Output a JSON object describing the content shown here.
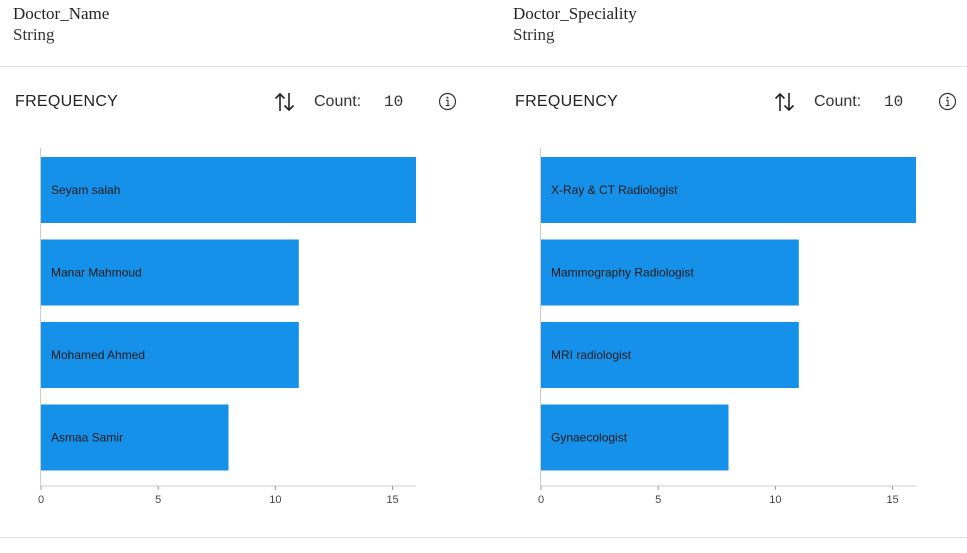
{
  "panels": [
    {
      "column_name": "Doctor_Name",
      "column_type": "String",
      "frequency_label": "FREQUENCY",
      "count_label": "Count:",
      "count_value": "10"
    },
    {
      "column_name": "Doctor_Speciality",
      "column_type": "String",
      "frequency_label": "FREQUENCY",
      "count_label": "Count:",
      "count_value": "10"
    }
  ],
  "icons": {
    "sort": "sort-arrows-icon",
    "info": "info-icon"
  },
  "colors": {
    "bar": "#1591ea",
    "axis": "#cccccc"
  },
  "chart_data": [
    {
      "type": "bar",
      "orientation": "horizontal",
      "categories": [
        "Seyam salah",
        "Manar Mahmoud",
        "Mohamed Ahmed",
        "Asmaa Samir"
      ],
      "values": [
        16,
        11,
        11,
        8
      ],
      "xlim": [
        0,
        16
      ],
      "xticks": [
        "0",
        "5",
        "10",
        "15"
      ],
      "grid": false
    },
    {
      "type": "bar",
      "orientation": "horizontal",
      "categories": [
        "X-Ray & CT Radiologist",
        "Mammography Radiologist",
        "MRI radiologist",
        "Gynaecologist"
      ],
      "values": [
        16,
        11,
        11,
        8
      ],
      "xlim": [
        0,
        16
      ],
      "xticks": [
        "0",
        "5",
        "10",
        "15"
      ],
      "grid": false
    }
  ]
}
